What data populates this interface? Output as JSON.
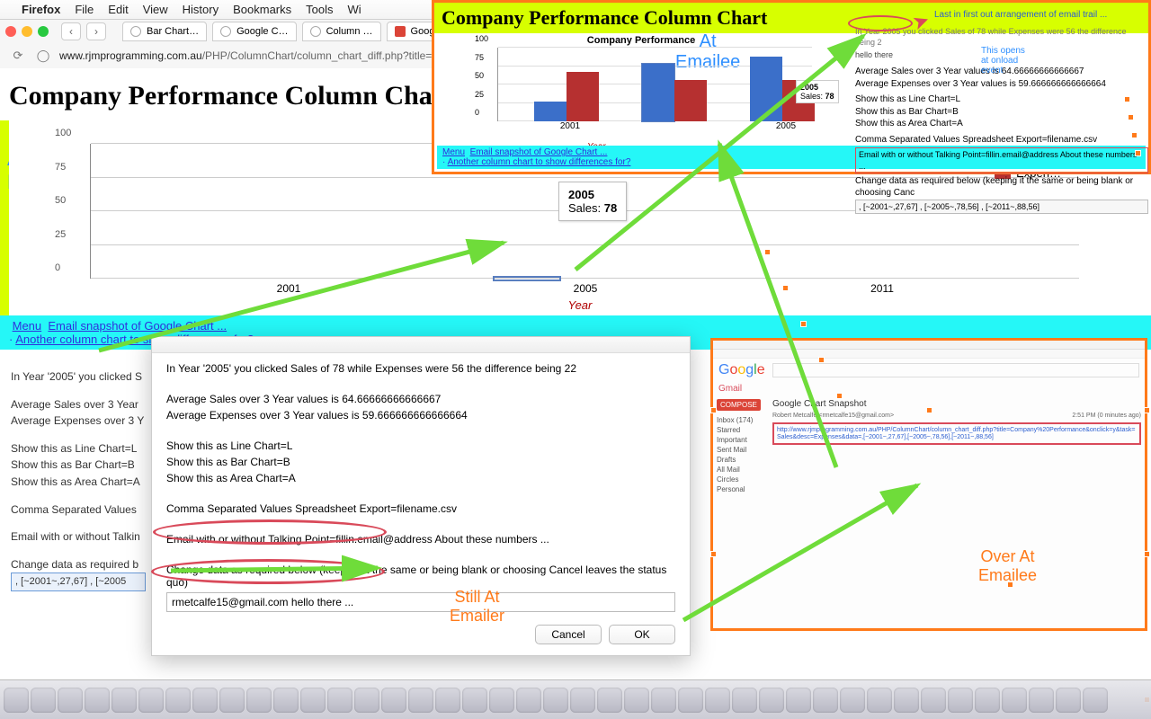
{
  "menubar": {
    "app": "Firefox",
    "items": [
      "File",
      "Edit",
      "View",
      "History",
      "Bookmarks",
      "Tools",
      "Wi"
    ]
  },
  "tabs": [
    "Bar Chart…",
    "Google C…",
    "Column …",
    "Google C"
  ],
  "url_host": "www.rjmprogramming.com.au",
  "url_path": "/PHP/ColumnChart/column_chart_diff.php?title=",
  "page_title": "Company Performance Column Chart",
  "at_emailer": "At\nEmailer",
  "chart_data": {
    "type": "bar",
    "title": "Company Performance",
    "categories": [
      "2001",
      "2005",
      "2011"
    ],
    "series": [
      {
        "name": "Sales",
        "values": [
          27,
          78,
          88
        ]
      },
      {
        "name": "Expen…",
        "values": [
          67,
          56,
          56
        ]
      }
    ],
    "ylim": [
      0,
      100
    ],
    "yticks": [
      0,
      25,
      50,
      75,
      100
    ],
    "xlabel": "Year",
    "tooltip": {
      "cat": "2005",
      "label": "Sales:",
      "value": "78"
    },
    "legend": [
      "Sales",
      "Expen…"
    ]
  },
  "links": {
    "menu": "Menu",
    "snap": "Email snapshot of Google Chart ...",
    "another": "Another column chart to show differences for?"
  },
  "info": {
    "l1": "In Year '2005' you clicked S",
    "l2": "Average Sales over 3 Year",
    "l3": "Average Expenses over 3 Y",
    "l4": "Show this as Line Chart=L",
    "l5": "Show this as Bar Chart=B",
    "l6": "Show this as Area Chart=A",
    "l7": "Comma Separated Values",
    "l8": "Email with or without Talkin",
    "l9": "Change data as required b",
    "data": ", [~2001~,27,67] , [~2005"
  },
  "dialog": {
    "clicked": "In Year '2005' you clicked Sales of 78 while Expenses were 56  the difference being 22",
    "avg_s": "Average Sales over 3 Year values is 64.66666666666667",
    "avg_e": "Average Expenses over 3 Year values is 59.666666666666664",
    "line": "Show this as Line Chart=L",
    "bar": "Show this as Bar Chart=B",
    "area": "Show this as Area Chart=A",
    "csv": "Comma Separated Values Spreadsheet Export=filename.csv",
    "email_hint": "Email with or without Talking Point=fillin.email@address About these numbers ...",
    "change": "Change data as required below (keeping it the same or being blank or choosing Cancel leaves the status quo)",
    "input_value": "rmetcalfe15@gmail.com hello there ...",
    "cancel": "Cancel",
    "ok": "OK"
  },
  "still_at": "Still At\nEmailer",
  "emailee_top": {
    "title": "Company Performance Column Chart",
    "at": "At\nEmailee",
    "mini_chart_title": "Company Performance",
    "tooltip": {
      "cat": "2005",
      "label": "Sales:",
      "value": "78"
    },
    "year": "Year",
    "menu": "Menu",
    "snap": "Email snapshot of Google Chart ...",
    "another": "Another column chart to show differences for?",
    "info_l0": "In Year 2005 you clicked Sales of 78 while Expenses were 56  the difference being 2",
    "hello": "hello there",
    "lifo": "Last in first out arrangement of email trail ...",
    "avg_s": "Average Sales over 3 Year values is 64.66666666666667",
    "avg_e": "Average Expenses over 3 Year values is 59.666666666666664",
    "line": "Show this as Line Chart=L",
    "bar": "Show this as Bar Chart=B",
    "area": "Show this as Area Chart=A",
    "this_opens": "This opens\nat onload\nevent",
    "csv": "Comma Separated Values Spreadsheet Export=filename.csv",
    "ebox": "Email with or without Talking Point=fillin.email@address About these numbers ...",
    "change": "Change data as required below (keeping it the same or being blank or choosing Canc",
    "row": ", [~2001~,27,67] , [~2005~,78,56] , [~2011~,88,56]"
  },
  "emailee_bot": {
    "gmail": "Gmail",
    "compose": "COMPOSE",
    "side": [
      "Inbox (174)",
      "Starred",
      "Important",
      "Sent Mail",
      "Drafts",
      "All Mail",
      "Circles",
      "Personal"
    ],
    "subject": "Google Chart Snapshot",
    "from": "Robert Metcalfe <rmetcalfe15@gmail.com>",
    "time": "2:51 PM (0 minutes ago)",
    "link": "http://www.rjmprogramming.com.au/PHP/ColumnChart/column_chart_diff.php?title=Company%20Performance&onclick=y&task=Sales&desc=Expenses&data=,[~2001~,27,67],[~2005~,78,56],[~2011~,88,56]",
    "over": "Over At\nEmailee"
  }
}
